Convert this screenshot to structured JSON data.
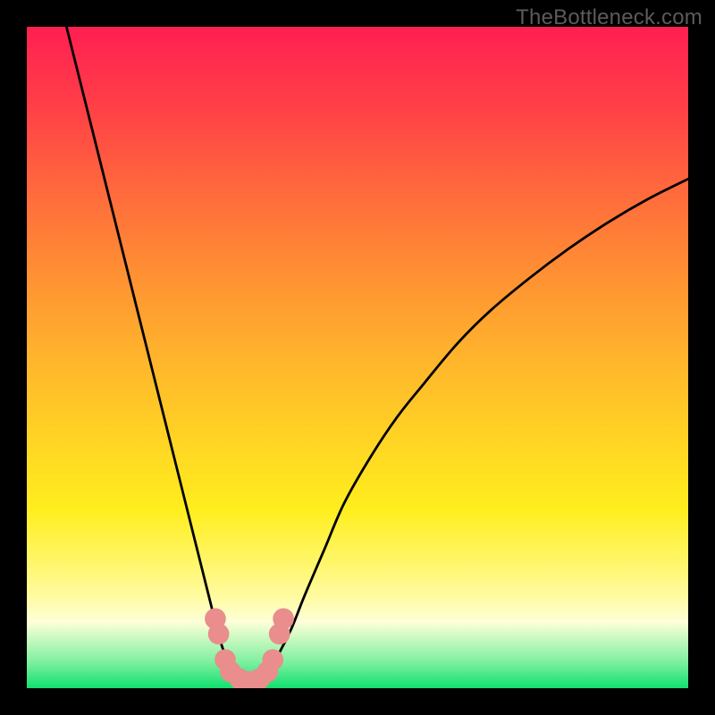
{
  "watermark": {
    "text": "TheBottleneck.com"
  },
  "chart_data": {
    "type": "line",
    "title": "",
    "xlabel": "",
    "ylabel": "",
    "xlim": [
      0,
      100
    ],
    "ylim": [
      0,
      100
    ],
    "series": [
      {
        "name": "curve-left",
        "x": [
          6,
          8,
          10,
          12,
          14,
          16,
          18,
          20,
          22,
          24,
          26,
          27,
          28,
          29,
          30,
          31,
          32,
          33,
          34
        ],
        "values": [
          100,
          92,
          84,
          76,
          68,
          60,
          52,
          44,
          36,
          28,
          20,
          16,
          12,
          8,
          5,
          3,
          1.5,
          0.5,
          0
        ]
      },
      {
        "name": "curve-right",
        "x": [
          34,
          35,
          36,
          37,
          38,
          40,
          42,
          45,
          48,
          52,
          56,
          60,
          65,
          70,
          76,
          82,
          88,
          94,
          100
        ],
        "values": [
          0,
          0.5,
          1.5,
          3,
          5,
          9,
          14,
          21,
          28,
          35,
          41,
          46,
          52,
          57,
          62,
          66.5,
          70.5,
          74,
          77
        ]
      }
    ],
    "markers": {
      "name": "bottom-cluster",
      "color": "#e98d8d",
      "points": [
        {
          "x": 28.5,
          "y": 10.5,
          "r": 1.6
        },
        {
          "x": 29.0,
          "y": 8.2,
          "r": 1.6
        },
        {
          "x": 30.0,
          "y": 4.3,
          "r": 1.6
        },
        {
          "x": 30.8,
          "y": 2.5,
          "r": 1.6
        },
        {
          "x": 32.2,
          "y": 1.4,
          "r": 1.6
        },
        {
          "x": 33.2,
          "y": 1.0,
          "r": 1.6
        },
        {
          "x": 34.2,
          "y": 1.0,
          "r": 1.6
        },
        {
          "x": 35.2,
          "y": 1.4,
          "r": 1.6
        },
        {
          "x": 36.4,
          "y": 2.5,
          "r": 1.6
        },
        {
          "x": 37.2,
          "y": 4.3,
          "r": 1.6
        },
        {
          "x": 38.2,
          "y": 8.2,
          "r": 1.6
        },
        {
          "x": 38.8,
          "y": 10.5,
          "r": 1.6
        }
      ]
    },
    "colors": {
      "curve_stroke": "#000000",
      "marker_fill": "#e98d8d"
    }
  }
}
